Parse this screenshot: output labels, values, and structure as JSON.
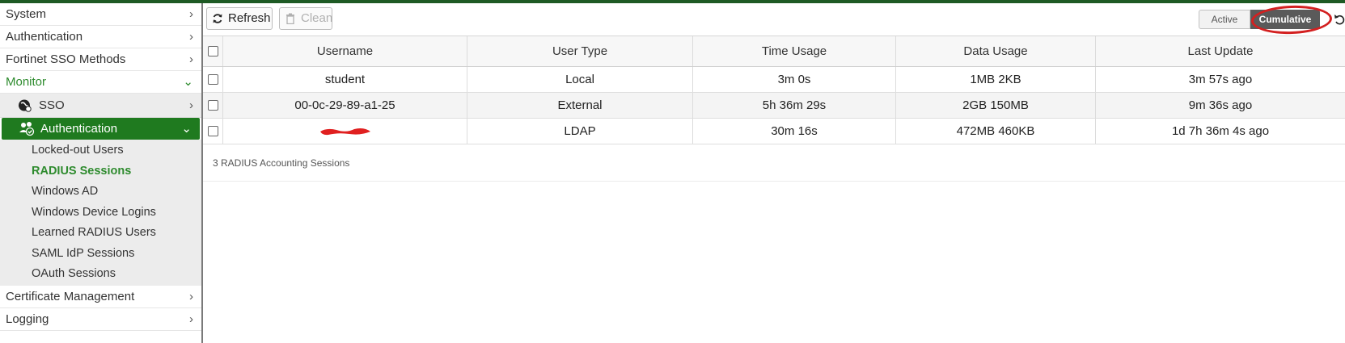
{
  "sidebar": {
    "items_top": [
      {
        "label": "System"
      },
      {
        "label": "Authentication"
      },
      {
        "label": "Fortinet SSO Methods"
      }
    ],
    "monitor_label": "Monitor",
    "sso_label": "SSO",
    "auth_label": "Authentication",
    "sub_items": [
      {
        "label": "Locked-out Users"
      },
      {
        "label": "RADIUS Sessions"
      },
      {
        "label": "Windows AD"
      },
      {
        "label": "Windows Device Logins"
      },
      {
        "label": "Learned RADIUS Users"
      },
      {
        "label": "SAML IdP Sessions"
      },
      {
        "label": "OAuth Sessions"
      }
    ],
    "items_bottom": [
      {
        "label": "Certificate Management"
      },
      {
        "label": "Logging"
      }
    ]
  },
  "toolbar": {
    "refresh_label": "Refresh",
    "clean_label": "Clean",
    "toggle_active_label": "Active",
    "toggle_cumulative_label": "Cumulative"
  },
  "table": {
    "columns": [
      "Username",
      "User Type",
      "Time Usage",
      "Data Usage",
      "Last Update"
    ],
    "rows": [
      {
        "username": "student",
        "user_type": "Local",
        "time_usage": "3m 0s",
        "data_usage": "1MB 2KB",
        "last_update": "3m 57s ago"
      },
      {
        "username": "00-0c-29-89-a1-25",
        "user_type": "External",
        "time_usage": "5h 36m 29s",
        "data_usage": "2GB 150MB",
        "last_update": "9m 36s ago"
      },
      {
        "username": "",
        "user_type": "LDAP",
        "time_usage": "30m 16s",
        "data_usage": "472MB 460KB",
        "last_update": "1d 7h 36m 4s ago"
      }
    ],
    "summary": "3 RADIUS Accounting Sessions"
  },
  "colors": {
    "brand_green": "#1f7a1f",
    "active_text_green": "#2e8b2e",
    "annotation_red": "#d32020"
  }
}
